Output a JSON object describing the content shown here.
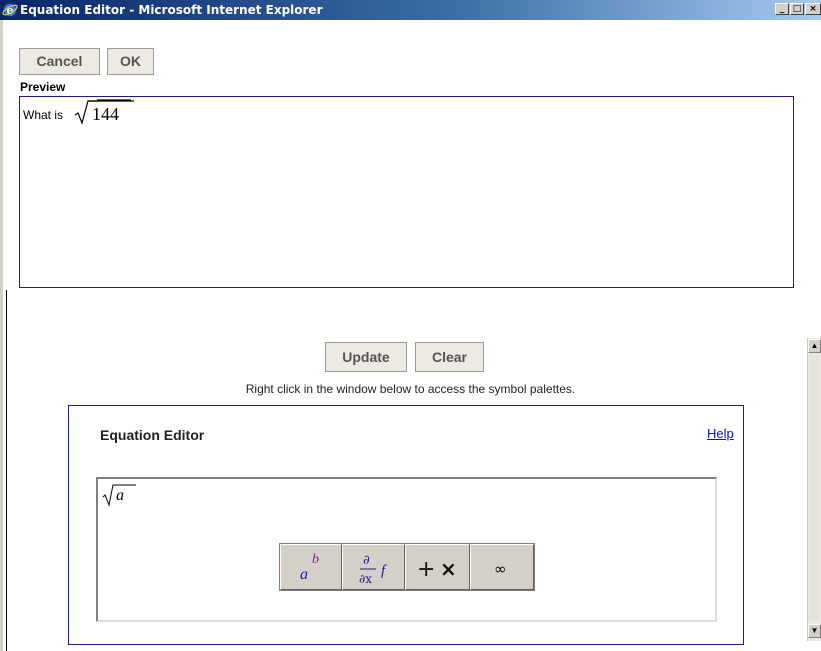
{
  "window": {
    "title": "Equation Editor - Microsoft Internet Explorer",
    "icon": "ie-icon",
    "minimize_glyph": "_",
    "maximize_glyph": "□",
    "close_glyph": "×"
  },
  "toolbar": {
    "cancel_label": "Cancel",
    "ok_label": "OK"
  },
  "preview": {
    "label": "Preview",
    "prefix_text": "What is",
    "radicand": "144"
  },
  "actions": {
    "update_label": "Update",
    "clear_label": "Clear",
    "hint": "Right click in the window below to access the symbol palettes."
  },
  "editor": {
    "title": "Equation Editor",
    "help_label": "Help",
    "expression_radicand": "a",
    "palette": [
      {
        "name": "superscript-palette",
        "icon": "power-icon",
        "glyphs": [
          "a",
          "b"
        ]
      },
      {
        "name": "calculus-palette",
        "icon": "partial-derivative-icon",
        "glyphs": [
          "∂",
          "∂x",
          "f"
        ]
      },
      {
        "name": "operators-palette",
        "icon": "plus-times-icon",
        "glyphs": [
          "+",
          "×"
        ]
      },
      {
        "name": "symbols-palette",
        "icon": "infinity-icon",
        "glyphs": [
          "∞"
        ]
      }
    ]
  },
  "scrollbar": {
    "up_glyph": "▲",
    "down_glyph": "▼"
  },
  "colors": {
    "title_gradient_start": "#0a246a",
    "title_gradient_end": "#a6caf0",
    "panel_border": "#1c1c8c",
    "link": "#1010c0",
    "palette_a": "#1a1ac8",
    "palette_b": "#8a1a8a"
  }
}
